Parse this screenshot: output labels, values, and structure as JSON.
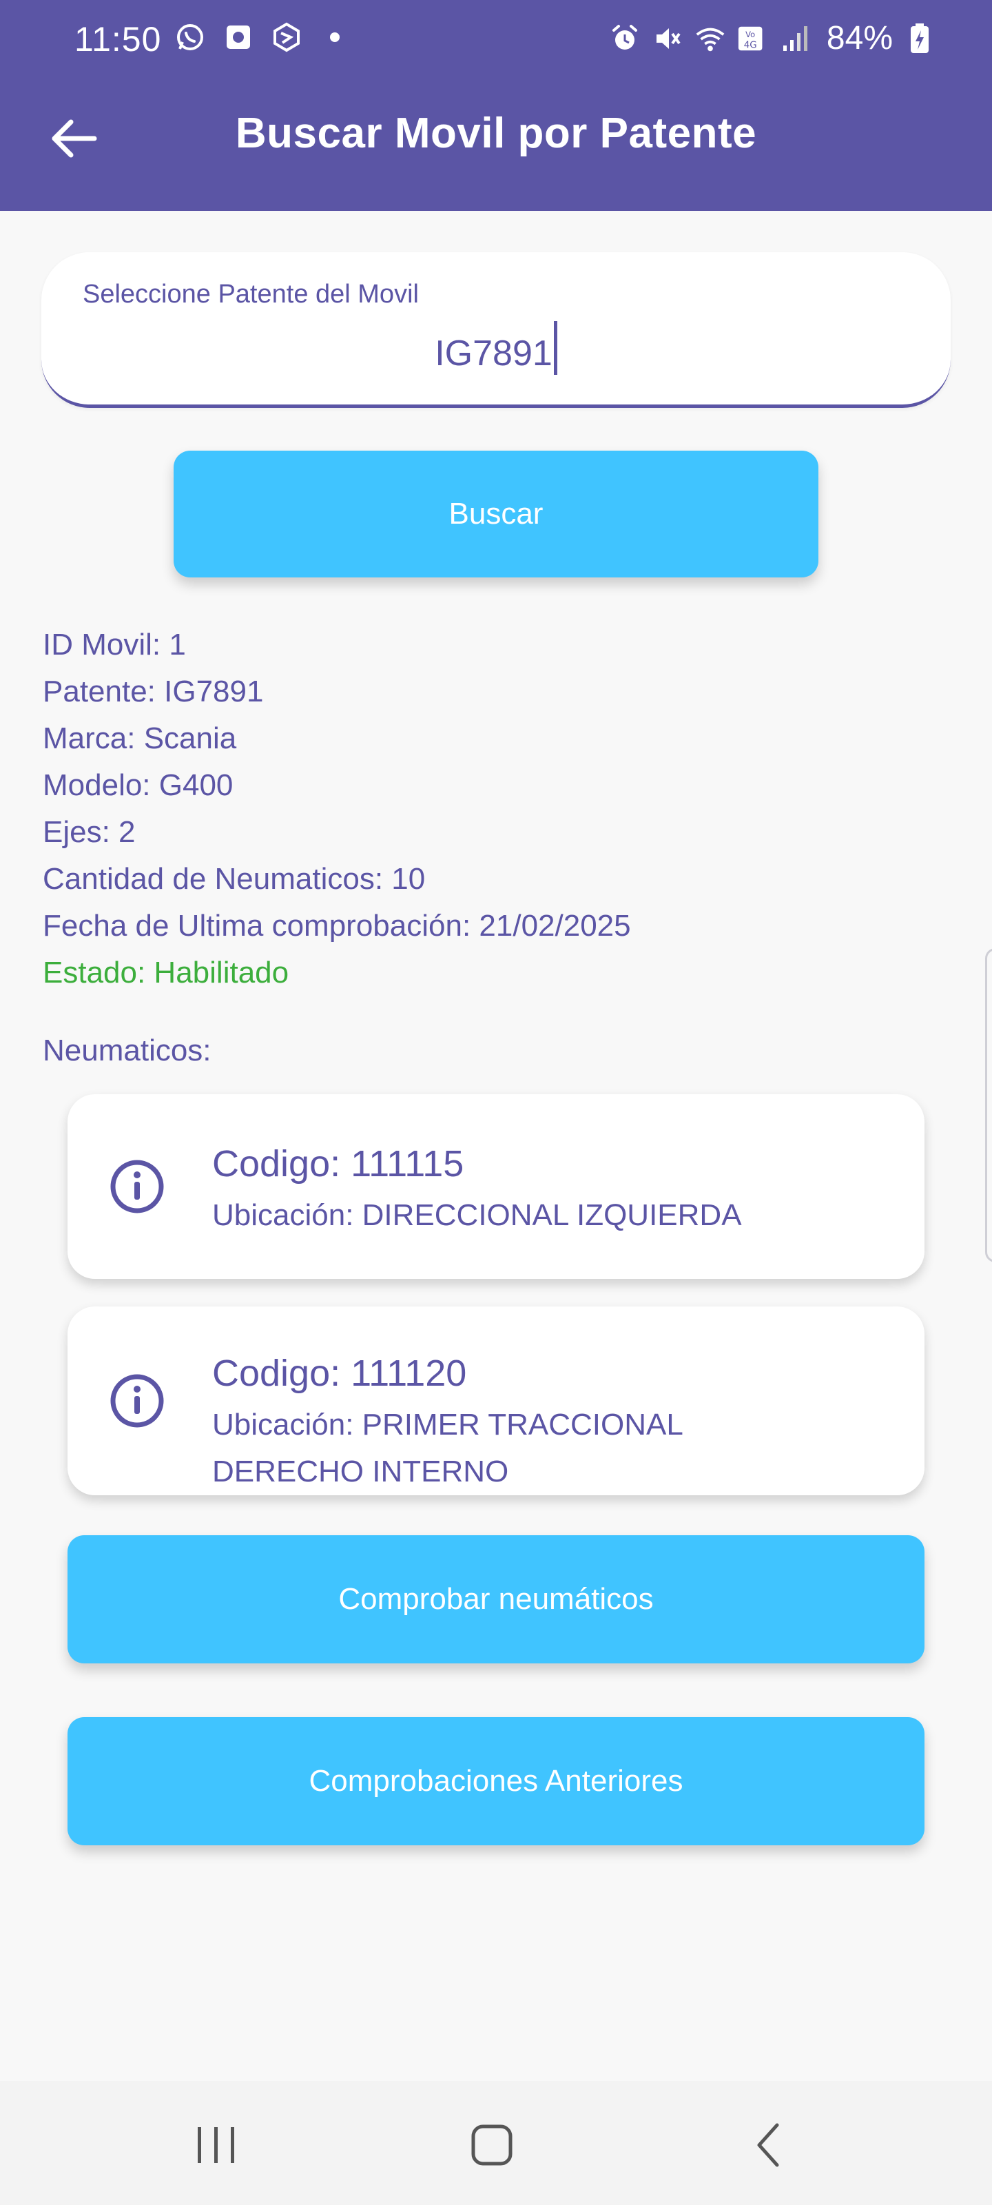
{
  "status_bar": {
    "time": "11:50",
    "left_icons": [
      "whatsapp-icon",
      "notification-app-icon",
      "bing-icon",
      "dot-icon"
    ],
    "right_icons": [
      "alarm-icon",
      "mute-icon",
      "wifi-icon",
      "volte-4g-icon",
      "signal-icon",
      "battery-charging-icon"
    ],
    "battery": "84%"
  },
  "app_bar": {
    "title": "Buscar Movil por Patente",
    "back_icon": "arrow-left-icon"
  },
  "search": {
    "label": "Seleccione Patente del Movil",
    "value": "IG7891",
    "button_label": "Buscar"
  },
  "vehicle": {
    "id_line": "ID Movil: 1",
    "patente_line": "Patente: IG7891",
    "marca_line": "Marca: Scania",
    "modelo_line": "Modelo: G400",
    "ejes_line": "Ejes: 2",
    "neumaticos_count_line": "Cantidad de Neumaticos: 10",
    "fecha_line": "Fecha de Ultima comprobación: 21/02/2025",
    "estado_line": "Estado: Habilitado"
  },
  "tires": {
    "section_label": "Neumaticos:",
    "items": [
      {
        "title": "Codigo: 111115",
        "location": "Ubicación: DIRECCIONAL IZQUIERDA",
        "icon": "info-icon"
      },
      {
        "title": "Codigo: 111120",
        "location": "Ubicación: PRIMER TRACCIONAL DERECHO INTERNO",
        "icon": "info-icon"
      }
    ]
  },
  "actions": {
    "comprobar_label": "Comprobar neumáticos",
    "anteriores_label": "Comprobaciones Anteriores"
  },
  "colors": {
    "primary": "#5b55a5",
    "button": "#40c4ff",
    "status_ok": "#3cae3c",
    "background": "#f8f8f8"
  },
  "navbar": {
    "icons": [
      "recents-icon",
      "home-icon",
      "back-icon"
    ]
  }
}
